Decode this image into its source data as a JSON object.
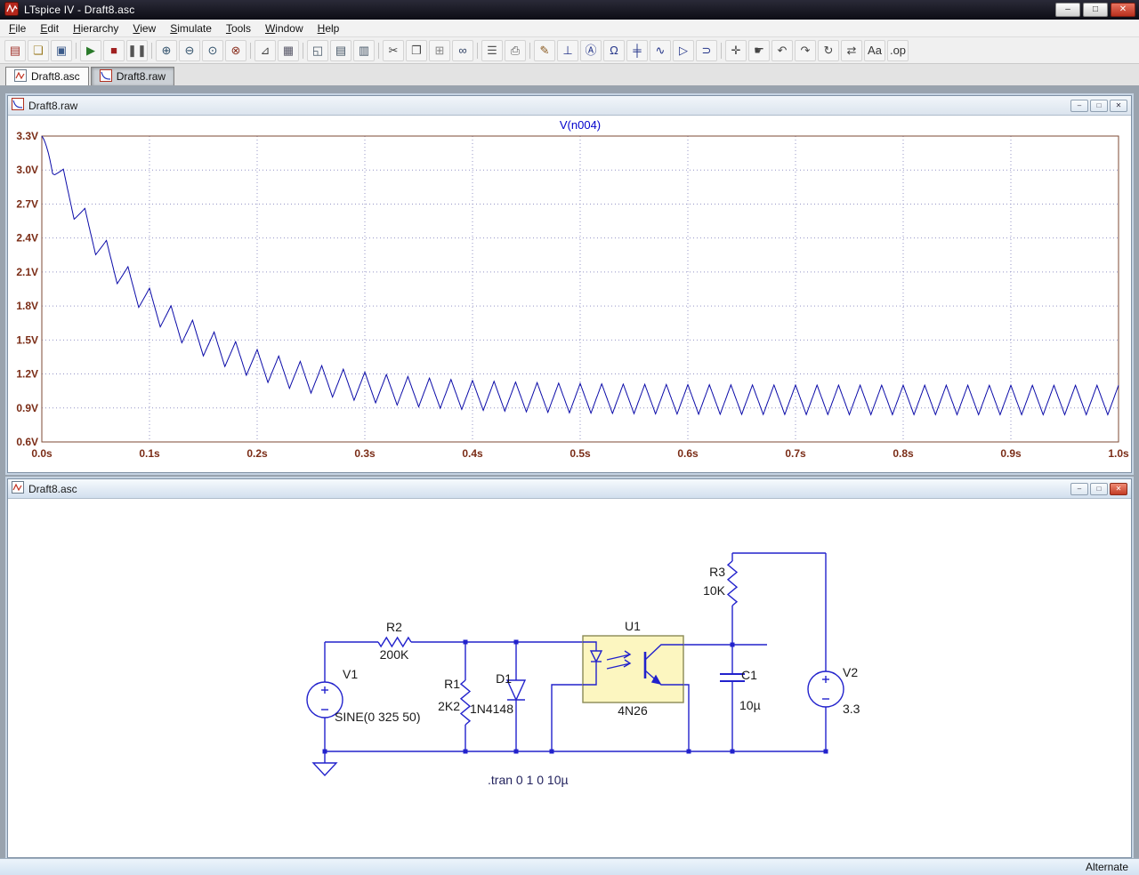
{
  "app": {
    "title": "LTspice IV - Draft8.asc"
  },
  "window_controls": {
    "minimize": "–",
    "maximize": "□",
    "close": "✕"
  },
  "menu": {
    "items": [
      {
        "label": "File",
        "u": 0
      },
      {
        "label": "Edit",
        "u": 0
      },
      {
        "label": "Hierarchy",
        "u": 0
      },
      {
        "label": "View",
        "u": 0
      },
      {
        "label": "Simulate",
        "u": 0
      },
      {
        "label": "Tools",
        "u": 0
      },
      {
        "label": "Window",
        "u": 0
      },
      {
        "label": "Help",
        "u": 0
      }
    ]
  },
  "toolbar": {
    "groups": [
      {
        "buttons": [
          {
            "name": "new-schematic",
            "glyph": "▤",
            "color": "#a03028"
          },
          {
            "name": "open-file",
            "glyph": "❏",
            "color": "#9a7a20"
          },
          {
            "name": "save-file",
            "glyph": "▣",
            "color": "#3a5a8a"
          }
        ]
      },
      {
        "buttons": [
          {
            "name": "run-simulation",
            "glyph": "▶",
            "color": "#2a7a2a"
          },
          {
            "name": "halt-simulation",
            "glyph": "■",
            "color": "#a02020"
          },
          {
            "name": "pause-simulation",
            "glyph": "❚❚",
            "color": "#555555"
          }
        ]
      },
      {
        "buttons": [
          {
            "name": "zoom-area",
            "glyph": "⊕",
            "color": "#30506a"
          },
          {
            "name": "zoom-back",
            "glyph": "⊖",
            "color": "#30506a"
          },
          {
            "name": "zoom-out",
            "glyph": "⊙",
            "color": "#30506a"
          },
          {
            "name": "zoom-full-extents",
            "glyph": "⊗",
            "color": "#8a3020"
          }
        ]
      },
      {
        "buttons": [
          {
            "name": "autorange",
            "glyph": "⊿",
            "color": "#444444"
          },
          {
            "name": "grid",
            "glyph": "▦",
            "color": "#555566"
          }
        ]
      },
      {
        "buttons": [
          {
            "name": "cascade-windows",
            "glyph": "◱",
            "color": "#445566"
          },
          {
            "name": "tile-horizontal",
            "glyph": "▤",
            "color": "#445566"
          },
          {
            "name": "tile-vertical",
            "glyph": "▥",
            "color": "#445566"
          }
        ]
      },
      {
        "buttons": [
          {
            "name": "cut",
            "glyph": "✂",
            "color": "#444444"
          },
          {
            "name": "copy",
            "glyph": "❐",
            "color": "#444444"
          },
          {
            "name": "paste",
            "glyph": "⊞",
            "color": "#888888"
          },
          {
            "name": "find",
            "glyph": "∞",
            "color": "#334466"
          }
        ]
      },
      {
        "buttons": [
          {
            "name": "print-preview",
            "glyph": "☰",
            "color": "#555555"
          },
          {
            "name": "print",
            "glyph": "⎙",
            "color": "#555555"
          }
        ]
      },
      {
        "buttons": [
          {
            "name": "draw-wire",
            "glyph": "✎",
            "color": "#8a5a20"
          },
          {
            "name": "place-ground",
            "glyph": "⊥",
            "color": "#223388"
          },
          {
            "name": "label-net",
            "glyph": "Ⓐ",
            "color": "#223388"
          },
          {
            "name": "place-resistor",
            "glyph": "Ω",
            "color": "#223388"
          },
          {
            "name": "place-capacitor",
            "glyph": "╪",
            "color": "#223388"
          },
          {
            "name": "place-inductor",
            "glyph": "∿",
            "color": "#223388"
          },
          {
            "name": "place-diode",
            "glyph": "▷",
            "color": "#223388"
          },
          {
            "name": "place-component",
            "glyph": "⊃",
            "color": "#223388"
          }
        ]
      },
      {
        "buttons": [
          {
            "name": "move",
            "glyph": "✛",
            "color": "#444444"
          },
          {
            "name": "drag",
            "glyph": "☛",
            "color": "#444444"
          },
          {
            "name": "undo",
            "glyph": "↶",
            "color": "#444444"
          },
          {
            "name": "redo",
            "glyph": "↷",
            "color": "#444444"
          },
          {
            "name": "rotate",
            "glyph": "↻",
            "color": "#444444"
          },
          {
            "name": "mirror",
            "glyph": "⇄",
            "color": "#444444"
          },
          {
            "name": "text",
            "glyph": "Aa",
            "color": "#333333"
          },
          {
            "name": "spice-directive",
            "glyph": ".op",
            "color": "#333333"
          }
        ]
      }
    ]
  },
  "tabs": [
    {
      "label": "Draft8.asc"
    },
    {
      "label": "Draft8.raw"
    }
  ],
  "plot_window": {
    "title": "Draft8.raw"
  },
  "schematic_window": {
    "title": "Draft8.asc"
  },
  "chart_data": {
    "type": "line",
    "title": "V(n004)",
    "xlim": [
      0,
      1
    ],
    "ylim": [
      0.6,
      3.3
    ],
    "x_tick_values": [
      0,
      0.1,
      0.2,
      0.3,
      0.4,
      0.5,
      0.6,
      0.7,
      0.8,
      0.9,
      1.0
    ],
    "x_tick_labels": [
      "0.0s",
      "0.1s",
      "0.2s",
      "0.3s",
      "0.4s",
      "0.5s",
      "0.6s",
      "0.7s",
      "0.8s",
      "0.9s",
      "1.0s"
    ],
    "y_tick_values": [
      0.6,
      0.9,
      1.2,
      1.5,
      1.8,
      2.1,
      2.4,
      2.7,
      3.0,
      3.3
    ],
    "y_tick_labels": [
      "0.6V",
      "0.9V",
      "1.2V",
      "1.5V",
      "1.8V",
      "2.1V",
      "2.4V",
      "2.7V",
      "3.0V",
      "3.3V"
    ],
    "grid": true,
    "legend_position": "none",
    "plot_bg": "#ffffff",
    "frame_color": "#7e4a33",
    "grid_color": "#9494c6",
    "tick_label_color": "#7a2c16",
    "title_color": "#0000cc",
    "series": [
      {
        "name": "V(n004)",
        "color": "#0a0aa8",
        "model": {
          "type": "exponential-decay-with-sawtooth-ripple",
          "v_init": 3.3,
          "v_final_mid": 0.97,
          "tau_s": 0.1,
          "ripple_freq_hz": 50,
          "ripple_amplitude_v": 0.13,
          "steady_state_min_v": 0.84,
          "steady_state_max_v": 1.1
        },
        "envelope_samples_t_v": [
          [
            0,
            3.3
          ],
          [
            0.05,
            2.38
          ],
          [
            0.1,
            1.83
          ],
          [
            0.15,
            1.49
          ],
          [
            0.2,
            1.29
          ],
          [
            0.25,
            1.16
          ],
          [
            0.3,
            1.09
          ],
          [
            0.4,
            1.01
          ],
          [
            0.5,
            0.99
          ],
          [
            0.75,
            0.97
          ],
          [
            1.0,
            0.97
          ]
        ]
      }
    ]
  },
  "schematic": {
    "components": [
      {
        "id": "V1",
        "type": "voltage-source",
        "value": "SINE(0 325 50)"
      },
      {
        "id": "R2",
        "type": "resistor",
        "value": "200K"
      },
      {
        "id": "R1",
        "type": "resistor",
        "value": "2K2"
      },
      {
        "id": "D1",
        "type": "diode",
        "value": "1N4148"
      },
      {
        "id": "U1",
        "type": "optocoupler",
        "value": "4N26"
      },
      {
        "id": "C1",
        "type": "capacitor",
        "value": "10µ"
      },
      {
        "id": "R3",
        "type": "resistor",
        "value": "10K"
      },
      {
        "id": "V2",
        "type": "voltage-source",
        "value": "3.3"
      }
    ],
    "directive": ".tran 0 1 0 10µ",
    "colors": {
      "wire": "#2222cc",
      "label": "#1a1a1a",
      "opto_fill": "#fcf6c0",
      "opto_border": "#8a8a55",
      "directive": "#23235e"
    }
  },
  "status_bar": {
    "mode": "Alternate"
  }
}
